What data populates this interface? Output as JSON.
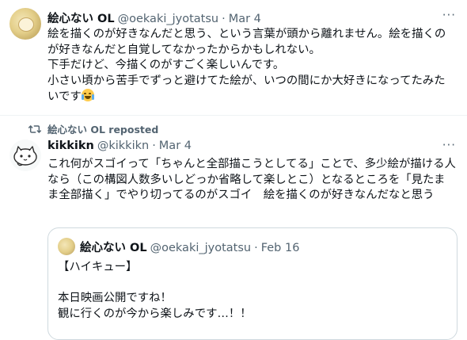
{
  "tweet1": {
    "name": "絵心ない OL",
    "handle": "@oekaki_jyotatsu",
    "date": "Mar 4",
    "text": "絵を描くのが好きなんだと思う、という言葉が頭から離れません。絵を描くのが好きなんだと自覚してなかったからかもしれない。\n下手だけど、今描くのがすごく楽しいんです。\n小さい頃から苦手でずっと避けてた絵が、いつの間にか大好きになってたみたいです",
    "emoji": "laughing-with-tears-emoji"
  },
  "tweet2": {
    "repost_label": "絵心ない OL reposted",
    "name": "kikkikn",
    "handle": "@kikkikn",
    "date": "Mar 4",
    "text": "これ何がスゴイって「ちゃんと全部描こうとしてる」ことで、多少絵が描ける人なら（この構図人数多いしどっか省略して楽しとこ）となるところを「見たまま全部描く」でやり切ってるのがスゴイ　絵を描くのが好きなんだなと思う"
  },
  "quote": {
    "name": "絵心ない OL",
    "handle": "@oekaki_jyotatsu",
    "date": "Feb 16",
    "text": "【ハイキュー】\n\n本日映画公開ですね！\n観に行くのが今から楽しみです…！！"
  },
  "icons": {
    "more": "more-horizontal-icon",
    "repost": "repost-icon"
  },
  "colors": {
    "text": "#0f1419",
    "secondary": "#536471",
    "border": "#cfd9de"
  }
}
